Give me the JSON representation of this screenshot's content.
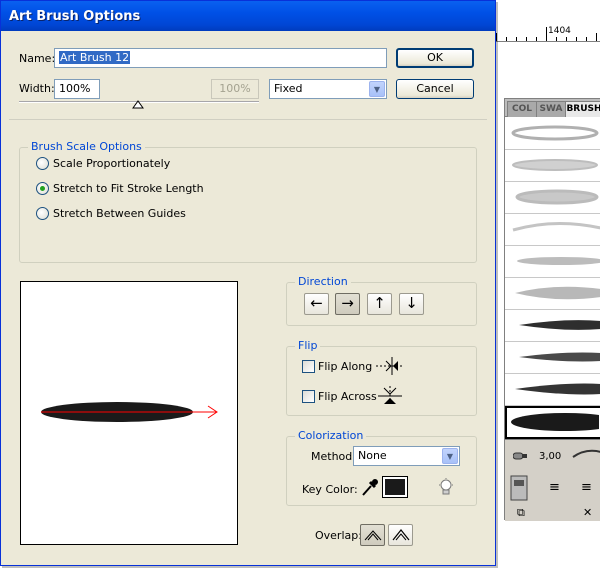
{
  "dialog": {
    "title": "Art Brush Options",
    "name_label": "Name:",
    "name_value": "Art Brush 12",
    "width_label": "Width:",
    "width_value": "100%",
    "width_disabled_value": "100%",
    "width_mode": "Fixed",
    "ok_label": "OK",
    "cancel_label": "Cancel",
    "brush_scale": {
      "title": "Brush Scale Options",
      "options": [
        {
          "label": "Scale Proportionately",
          "checked": false
        },
        {
          "label": "Stretch to Fit Stroke Length",
          "checked": true
        },
        {
          "label": "Stretch Between Guides",
          "checked": false
        }
      ]
    },
    "direction": {
      "title": "Direction",
      "buttons": [
        "←",
        "→",
        "↑",
        "↓"
      ],
      "selected": "→"
    },
    "flip": {
      "title": "Flip",
      "along_label": "Flip Along",
      "across_label": "Flip Across"
    },
    "colorization": {
      "title": "Colorization",
      "method_label": "Method:",
      "method_value": "None",
      "key_color_label": "Key Color:",
      "key_color": "#1a1a1a"
    },
    "overlap_label": "Overlap:"
  },
  "background_panel": {
    "tabs": [
      "COL",
      "SWA",
      "BRUSH"
    ],
    "ruler_label": "1404",
    "footer_value": "3,00"
  },
  "colors": {
    "titlebar": "#0054e3",
    "dialog_bg": "#ece9d8",
    "group_title": "#0046d5",
    "stroke": "#1a1a1a",
    "path_line": "#ff0000"
  }
}
